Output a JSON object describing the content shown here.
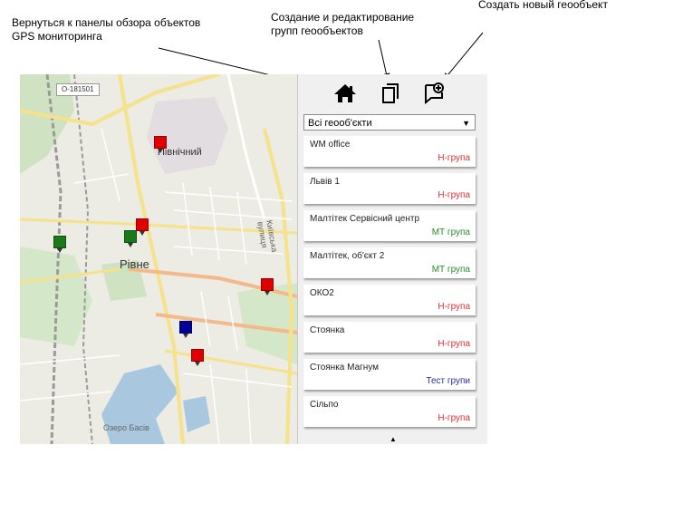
{
  "annotations": {
    "back_overview": "Вернуться к панелы обзора объектов\nGPS мониторинга",
    "create_edit_groups": "Создание и редактирование\nгрупп геообъектов",
    "create_new": "Создать новый геообъект"
  },
  "map": {
    "road_badge": "О-181501",
    "labels": {
      "pivnichnyi": "Північний",
      "rivne": "Рівне",
      "kyivska": "Київська вулиця",
      "lake": "Озеро Басів"
    },
    "markers": [
      {
        "color": "#e00000"
      },
      {
        "color": "#e00000"
      },
      {
        "color": "#1a7a1a"
      },
      {
        "color": "#1a7a1a"
      },
      {
        "color": "#e00000"
      },
      {
        "color": "#000099"
      },
      {
        "color": "#e00000"
      }
    ]
  },
  "panel": {
    "icons": [
      "home-icon",
      "copy-icon",
      "add-geoobject-icon"
    ],
    "filter": {
      "selected": "Всі геооб'єкти"
    },
    "items": [
      {
        "name": "WM office",
        "group": "Н-група",
        "color": "#e03030"
      },
      {
        "name": "Львів 1",
        "group": "Н-група",
        "color": "#e03030"
      },
      {
        "name": "Малтітек Сервісний центр",
        "group": "МТ група",
        "color": "#2a8a2a"
      },
      {
        "name": "Малтітек, об'єкт 2",
        "group": "МТ група",
        "color": "#2a8a2a"
      },
      {
        "name": "ОКО2",
        "group": "Н-група",
        "color": "#e03030"
      },
      {
        "name": "Стоянка",
        "group": "Н-група",
        "color": "#e03030"
      },
      {
        "name": "Стоянка Магнум",
        "group": "Тест групи",
        "color": "#2a2aa8"
      },
      {
        "name": "Сільпо",
        "group": "Н-група",
        "color": "#e03030"
      }
    ]
  }
}
